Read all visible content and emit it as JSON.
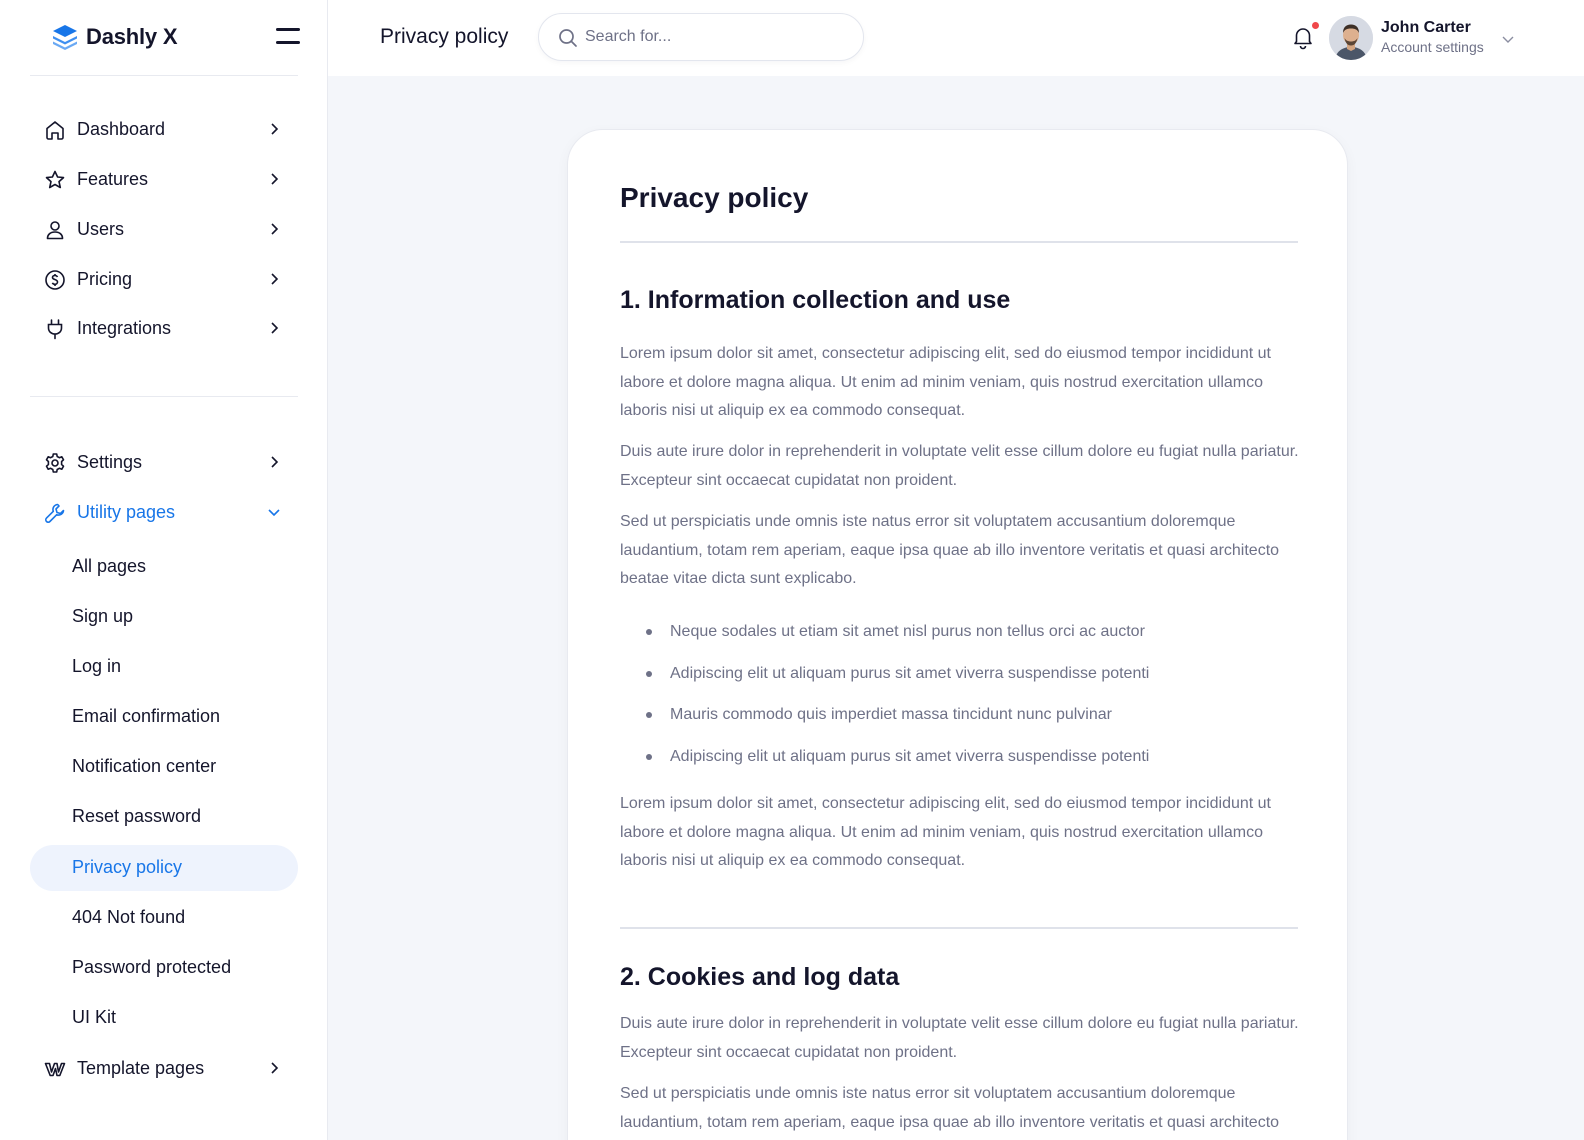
{
  "sidebar": {
    "brand": "Dashly X",
    "nav": [
      {
        "label": "Dashboard",
        "icon": "home-icon"
      },
      {
        "label": "Features",
        "icon": "star-icon"
      },
      {
        "label": "Users",
        "icon": "user-icon"
      },
      {
        "label": "Pricing",
        "icon": "dollar-icon"
      },
      {
        "label": "Integrations",
        "icon": "plug-icon"
      }
    ],
    "settings": {
      "label": "Settings",
      "icon": "gear-icon"
    },
    "utility": {
      "label": "Utility pages",
      "icon": "wrench-icon"
    },
    "utility_items": [
      "All pages",
      "Sign up",
      "Log in",
      "Email confirmation",
      "Notification center",
      "Reset password",
      "Privacy policy",
      "404 Not found",
      "Password protected",
      "UI Kit"
    ],
    "template": {
      "label": "Template pages",
      "icon": "webflow-icon"
    }
  },
  "topbar": {
    "title": "Privacy policy",
    "search_placeholder": "Search for...",
    "user_name": "John Carter",
    "user_sub": "Account settings"
  },
  "content": {
    "title": "Privacy policy",
    "section1_title": "1. Information collection and use",
    "s1_p1": "Lorem ipsum dolor sit amet, consectetur adipiscing elit, sed do eiusmod tempor incididunt ut labore et dolore magna aliqua. Ut enim ad minim veniam, quis nostrud exercitation ullamco laboris nisi ut aliquip ex ea commodo consequat.",
    "s1_p2": "Duis aute irure dolor in reprehenderit in voluptate velit esse cillum dolore eu fugiat nulla pariatur. Excepteur sint occaecat cupidatat non proident.",
    "s1_p3": "Sed ut perspiciatis unde omnis iste natus error sit voluptatem accusantium doloremque laudantium, totam rem aperiam, eaque ipsa quae ab illo inventore veritatis et quasi architecto beatae vitae dicta sunt explicabo.",
    "bullets": [
      "Neque sodales ut etiam sit amet nisl purus non tellus orci ac auctor",
      "Adipiscing elit ut aliquam purus sit amet viverra suspendisse potenti",
      "Mauris commodo quis imperdiet massa tincidunt nunc pulvinar",
      "Adipiscing elit ut aliquam purus sit amet viverra suspendisse potenti"
    ],
    "s1_p4": "Lorem ipsum dolor sit amet, consectetur adipiscing elit, sed do eiusmod tempor incididunt ut labore et dolore magna aliqua. Ut enim ad minim veniam, quis nostrud exercitation ullamco laboris nisi ut aliquip ex ea commodo consequat.",
    "section2_title": "2. Cookies and log data",
    "s2_p1": "Duis aute irure dolor in reprehenderit in voluptate velit esse cillum dolore eu fugiat nulla pariatur. Excepteur sint occaecat cupidatat non proident.",
    "s2_p2": "Sed ut perspiciatis unde omnis iste natus error sit voluptatem accusantium doloremque laudantium, totam rem aperiam, eaque ipsa quae ab illo inventore veritatis et quasi architecto"
  },
  "colors": {
    "accent": "#1876e8",
    "text": "#14152b",
    "muted": "#6e7187",
    "notification": "#f0474a"
  }
}
